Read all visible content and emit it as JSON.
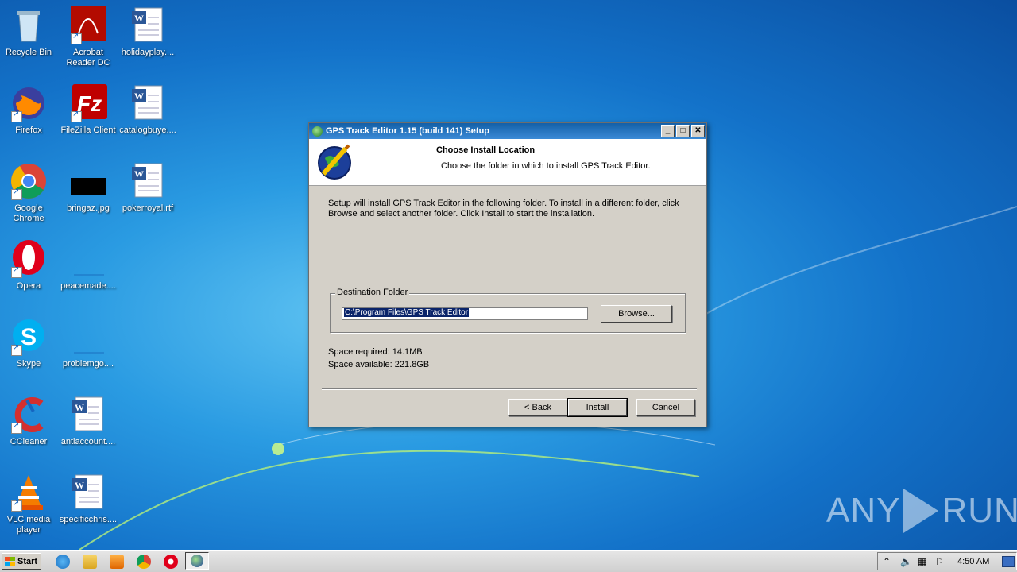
{
  "desktop": {
    "icons": [
      {
        "label": "Recycle Bin",
        "icon": "recycle-bin-icon"
      },
      {
        "label": "Acrobat Reader DC",
        "icon": "acrobat-icon"
      },
      {
        "label": "holidayplay....",
        "icon": "word-doc-icon"
      },
      {
        "label": "Firefox",
        "icon": "firefox-icon"
      },
      {
        "label": "FileZilla Client",
        "icon": "filezilla-icon"
      },
      {
        "label": "catalogbuye....",
        "icon": "word-doc-icon"
      },
      {
        "label": "Google Chrome",
        "icon": "chrome-icon"
      },
      {
        "label": "bringaz.jpg",
        "icon": "image-file-icon"
      },
      {
        "label": "pokerroyal.rtf",
        "icon": "word-doc-icon"
      },
      {
        "label": "Opera",
        "icon": "opera-icon"
      },
      {
        "label": "peacemade....",
        "icon": "blank-file-icon"
      },
      {
        "label": "Skype",
        "icon": "skype-icon"
      },
      {
        "label": "problemgo....",
        "icon": "blank-file-icon"
      },
      {
        "label": "CCleaner",
        "icon": "ccleaner-icon"
      },
      {
        "label": "antiaccount....",
        "icon": "word-doc-icon"
      },
      {
        "label": "VLC media player",
        "icon": "vlc-icon"
      },
      {
        "label": "specificchris....",
        "icon": "word-doc-icon"
      }
    ]
  },
  "dialog": {
    "title": "GPS Track Editor 1.15 (build 141) Setup",
    "header_title": "Choose Install Location",
    "header_subtitle": "Choose the folder in which to install GPS Track Editor.",
    "body_line1": "Setup will install GPS Track Editor in the following folder. To install in a different folder, click",
    "body_line2": "Browse and select another folder. Click Install to start the installation.",
    "group_label": "Destination Folder",
    "path_value": "C:\\Program Files\\GPS Track Editor",
    "browse_label": "Browse...",
    "space_required": "Space required: 14.1MB",
    "space_available": "Space available: 221.8GB",
    "back_label": "< Back",
    "install_label": "Install",
    "cancel_label": "Cancel",
    "min_glyph": "_",
    "max_glyph": "□",
    "close_glyph": "✕"
  },
  "taskbar": {
    "start_label": "Start",
    "clock": "4:50 AM",
    "items": [
      "ie-icon",
      "explorer-icon",
      "media-player-icon",
      "chrome-icon",
      "opera-icon",
      "gps-track-editor-icon"
    ]
  },
  "watermark": {
    "text_left": "ANY",
    "text_right": "RUN"
  },
  "colors": {
    "titlebar": "#1360a8",
    "dialog_bg": "#d4d0c8",
    "selection": "#0a246a"
  }
}
